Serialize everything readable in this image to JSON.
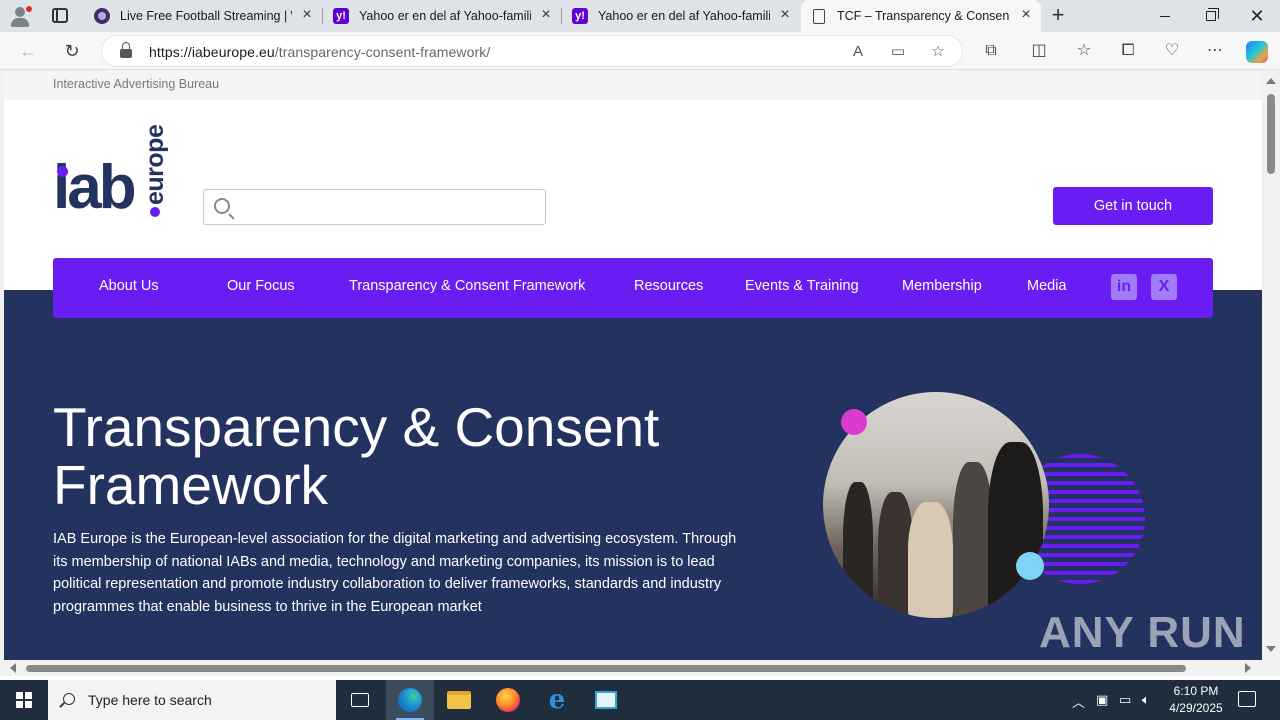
{
  "browser": {
    "tabs": [
      {
        "title": "Live Free Football Streaming | Wa",
        "active": false
      },
      {
        "title": "Yahoo er en del af Yahoo-familien",
        "active": false
      },
      {
        "title": "Yahoo er en del af Yahoo-familien",
        "active": false
      },
      {
        "title": "TCF – Transparency & Consent Fr",
        "active": true
      }
    ],
    "url_host": "https://iabeurope.eu",
    "url_path": "/transparency-consent-framework/"
  },
  "site": {
    "topbar_text": "Interactive Advertising Bureau",
    "logo": {
      "main": "iab",
      "sub": "europe"
    },
    "search": {
      "placeholder": ""
    },
    "cta_label": "Get in touch",
    "menu": [
      "About Us",
      "Our Focus",
      "Transparency & Consent Framework",
      "Resources",
      "Events & Training",
      "Membership",
      "Media"
    ],
    "social": {
      "linkedin": "in",
      "x": "X"
    },
    "hero": {
      "title": "Transparency & Consent Framework",
      "text": "IAB Europe is the European-level association for the digital marketing and advertising ecosystem. Through its membership of national IABs and media, technology and marketing companies, its mission is to lead political representation and promote industry collaboration to deliver frameworks, standards and industry programmes that enable business to thrive in the European market"
    },
    "colors": {
      "primary": "#6a1df2",
      "navy": "#23325e",
      "pink": "#dd3bd0",
      "cyan": "#7fd3f5"
    }
  },
  "watermark": "ANY RUN",
  "taskbar": {
    "search_placeholder": "Type here to search",
    "time": "6:10 PM",
    "date": "4/29/2025"
  }
}
